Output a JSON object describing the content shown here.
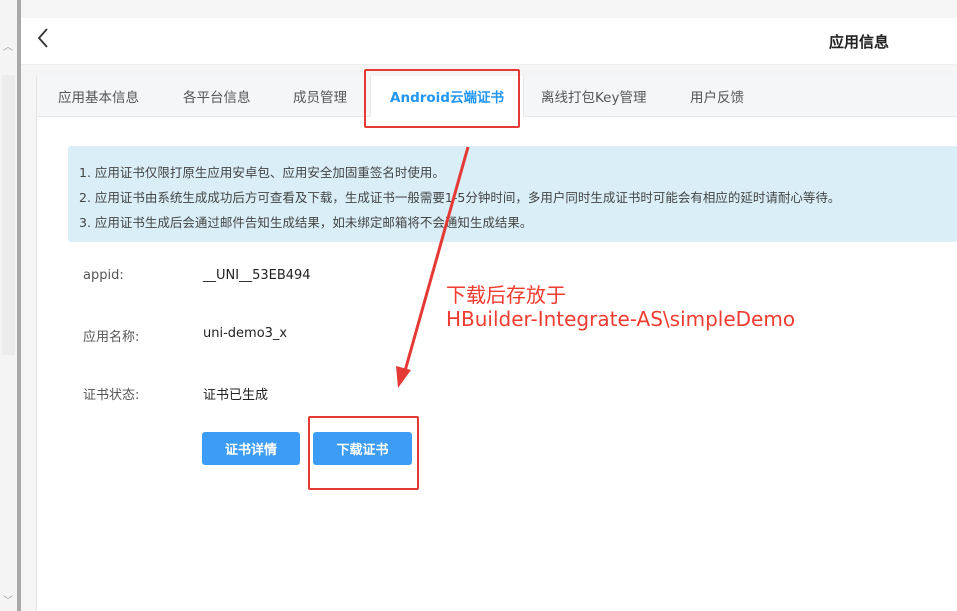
{
  "header": {
    "title": "应用信息"
  },
  "tabs": [
    {
      "label": "应用基本信息",
      "active": false
    },
    {
      "label": "各平台信息",
      "active": false
    },
    {
      "label": "成员管理",
      "active": false
    },
    {
      "label": "Android云端证书",
      "active": true
    },
    {
      "label": "离线打包Key管理",
      "active": false
    },
    {
      "label": "用户反馈",
      "active": false
    }
  ],
  "notice": [
    "1. 应用证书仅限打原生应用安卓包、应用安全加固重签名时使用。",
    "2. 应用证书由系统生成成功后方可查看及下载，生成证书一般需要1-5分钟时间，多用户同时生成证书时可能会有相应的延时请耐心等待。",
    "3. 应用证书生成后会通过邮件告知生成结果，如未绑定邮箱将不会通知生成结果。"
  ],
  "fields": {
    "appid": {
      "label": "appid:",
      "value": "__UNI__53EB494"
    },
    "app_name": {
      "label": "应用名称:",
      "value": "uni-demo3_x"
    },
    "cert_status": {
      "label": "证书状态:",
      "value": "证书已生成"
    }
  },
  "buttons": {
    "details": "证书详情",
    "download": "下载证书"
  },
  "annotation": {
    "line1": "下载后存放于",
    "line2": "HBuilder-Integrate-AS\\simpleDemo",
    "color": "#f03b30"
  },
  "colors": {
    "accent": "#2196f3",
    "button": "#3d9cf5",
    "notice_bg": "#d9eef7",
    "highlight": "#e53935"
  }
}
